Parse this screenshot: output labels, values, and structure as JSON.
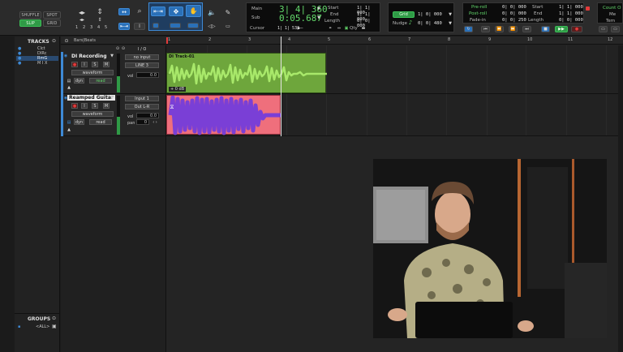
{
  "toolbar": {
    "edit_modes": [
      "SHUFFLE",
      "SPOT",
      "SLIP",
      "GRID"
    ],
    "zoom_presets": [
      "1",
      "2",
      "3",
      "4",
      "5"
    ]
  },
  "counter": {
    "main_label": "Main",
    "main_value": "3| 4| 360",
    "sub_label": "Sub",
    "sub_value": "0:05.687",
    "cursor_label": "Cursor",
    "cursor_value": "1| 1| 532",
    "start_label": "Start",
    "start_value": "1| 1| 000",
    "end_label": "End",
    "end_value": "1| 1| 000",
    "length_label": "Length",
    "length_value": "0| 0| 000",
    "qty_label": "Qty"
  },
  "grid": {
    "grid_label": "Grid",
    "grid_value": "1| 0| 000",
    "nudge_label": "Nudge",
    "nudge_value": "0| 0| 480"
  },
  "transport": {
    "preroll_label": "Pre-roll",
    "preroll_value": "0| 0| 000",
    "postroll_label": "Post-roll",
    "postroll_value": "0| 0| 000",
    "fadein_label": "Fade-in",
    "fadein_value": "0| 0| 250",
    "start_label": "Start",
    "start_value": "1| 1| 000",
    "end_label": "End",
    "end_value": "1| 1| 000",
    "length_label": "Length",
    "length_value": "0| 0| 000",
    "countoff_label": "Count O",
    "meter_label": "Me",
    "tempo_label": "Tem"
  },
  "tracks_panel": {
    "title": "TRACKS",
    "items": [
      "Clct",
      "DIRc",
      "RmG",
      "M I X"
    ],
    "groups_title": "GROUPS",
    "groups_item": "<ALL>"
  },
  "ruler": {
    "label": "Bars|Beats",
    "numbers": [
      "1",
      "2",
      "3",
      "4",
      "5",
      "6",
      "7",
      "8",
      "9",
      "10",
      "11",
      "12"
    ]
  },
  "io_header": "I / O",
  "tracks": [
    {
      "name": "DI Recording",
      "view": "waveform",
      "dyn": "dyn",
      "read": "read",
      "input": "no input",
      "output": "LINE 3",
      "vol_label": "vol",
      "vol_value": "0.0",
      "clip_name": "DI Track-01",
      "clip_gain": "+ 0 dB"
    },
    {
      "name": "Reamped Guitar",
      "view": "waveform",
      "dyn": "dyn",
      "read": "read",
      "input": "Input 1",
      "output": "Out L-R",
      "vol_label": "vol",
      "vol_value": "0.0",
      "pan_label": "pan",
      "pan_value": "0",
      "clip_name": "",
      "clip_gain": ""
    }
  ],
  "colors": {
    "di_clip": "#6ea63c",
    "di_wave": "#9ede5e",
    "reamp_clip": "#ef6f7c",
    "reamp_wave": "#7a3fd6",
    "selection": "#3c3c3c",
    "accent_green": "#2f9a46",
    "accent_blue": "#2a70b8"
  }
}
